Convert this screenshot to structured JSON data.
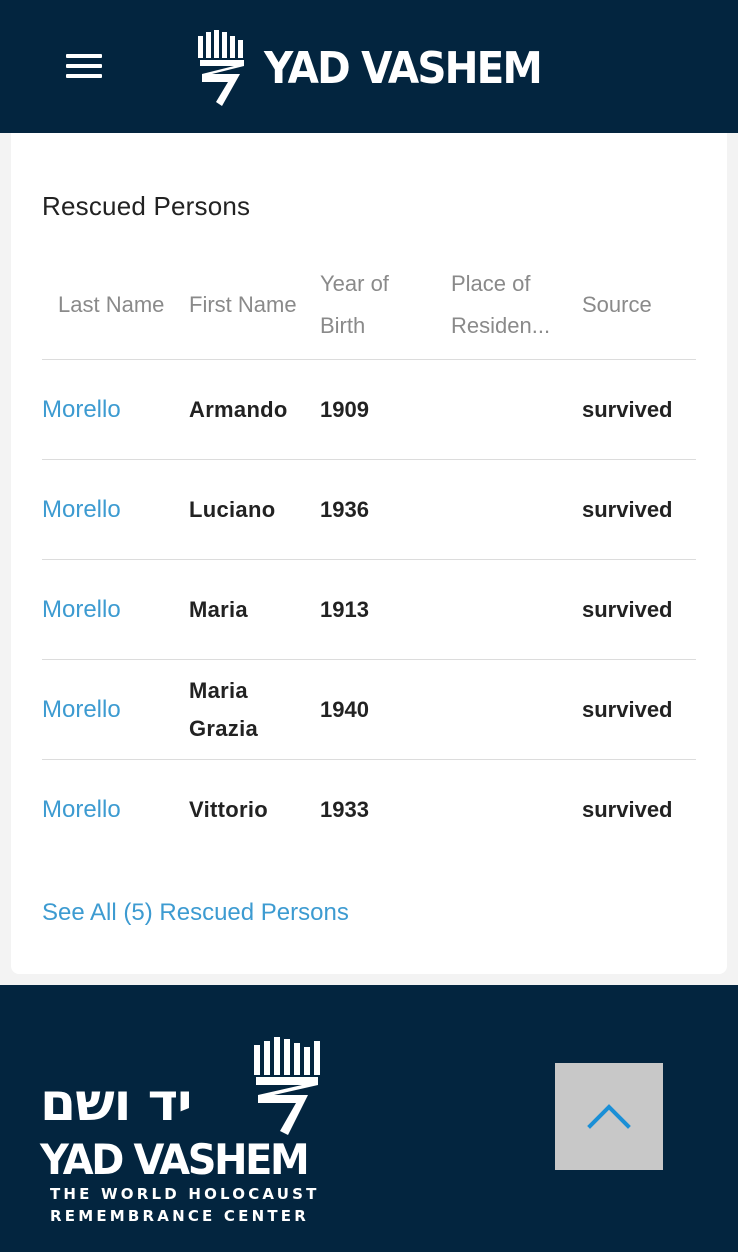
{
  "header": {
    "brand": "YAD VASHEM",
    "menu_icon": "hamburger-menu-icon",
    "logo_icon": "yad-vashem-menorah-logo-icon"
  },
  "rescued": {
    "title": "Rescued Persons",
    "columns": [
      "Last Name",
      "First Name",
      "Year of Birth",
      "Place of Residen...",
      "Source"
    ],
    "rows": [
      {
        "last": "Morello",
        "first": "Armando",
        "year": "1909",
        "place": "",
        "source": "survived"
      },
      {
        "last": "Morello",
        "first": "Luciano",
        "year": "1936",
        "place": "",
        "source": "survived"
      },
      {
        "last": "Morello",
        "first": "Maria",
        "year": "1913",
        "place": "",
        "source": "survived"
      },
      {
        "last": "Morello",
        "first": "Maria Grazia",
        "year": "1940",
        "place": "",
        "source": "survived"
      },
      {
        "last": "Morello",
        "first": "Vittorio",
        "year": "1933",
        "place": "",
        "source": "survived"
      }
    ],
    "see_all": "See All (5) Rescued Persons"
  },
  "footer": {
    "hebrew": "יד ושם",
    "brand": "YAD VASHEM",
    "tagline_1": "THE WORLD HOLOCAUST",
    "tagline_2": "REMEMBRANCE CENTER",
    "back_to_top_icon": "chevron-up-icon"
  },
  "colors": {
    "navy": "#03253f",
    "link": "#3d9bd1",
    "back_to_top_bg": "#c8c8c8"
  }
}
